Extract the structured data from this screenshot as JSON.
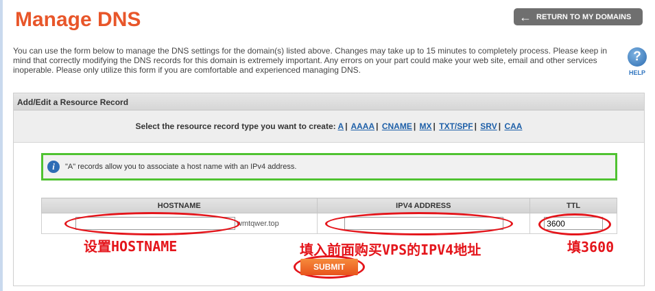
{
  "page": {
    "title": "Manage DNS",
    "return_button": "RETURN TO MY DOMAINS",
    "intro_text": "You can use the form below to manage the DNS settings for the domain(s) listed above. Changes may take up to 15 minutes to completely process. Please keep in mind that correctly modifying the DNS records for this domain is extremely important. Any errors on your part could make your web site, email and other services inoperable. Please only utilize this form if you are comfortable and experienced managing DNS.",
    "help_label": "HELP"
  },
  "panel": {
    "header": "Add/Edit a Resource Record",
    "type_prompt": "Select the resource record type you want to create:",
    "record_types": [
      "A",
      "AAAA",
      "CNAME",
      "MX",
      "TXT/SPF",
      "SRV",
      "CAA"
    ],
    "info_text": "\"A\" records allow you to associate a host name with an IPv4 address."
  },
  "table": {
    "headers": [
      "HOSTNAME",
      "IPV4 ADDRESS",
      "TTL"
    ],
    "hostname_value": "",
    "domain_suffix": "wmtqwer.top",
    "ipv4_value": "",
    "ttl_value": "3600"
  },
  "submit_label": "SUBMIT",
  "annotations": {
    "hostname": "设置HOSTNAME",
    "ipv4": "填入前面购买VPS的IPV4地址",
    "ttl": "填3600"
  },
  "colors": {
    "title": "#e8562a",
    "annotation": "#e4151b",
    "info_border": "#4fc231",
    "link": "#1d5fa8",
    "submit": "#e8531c"
  }
}
